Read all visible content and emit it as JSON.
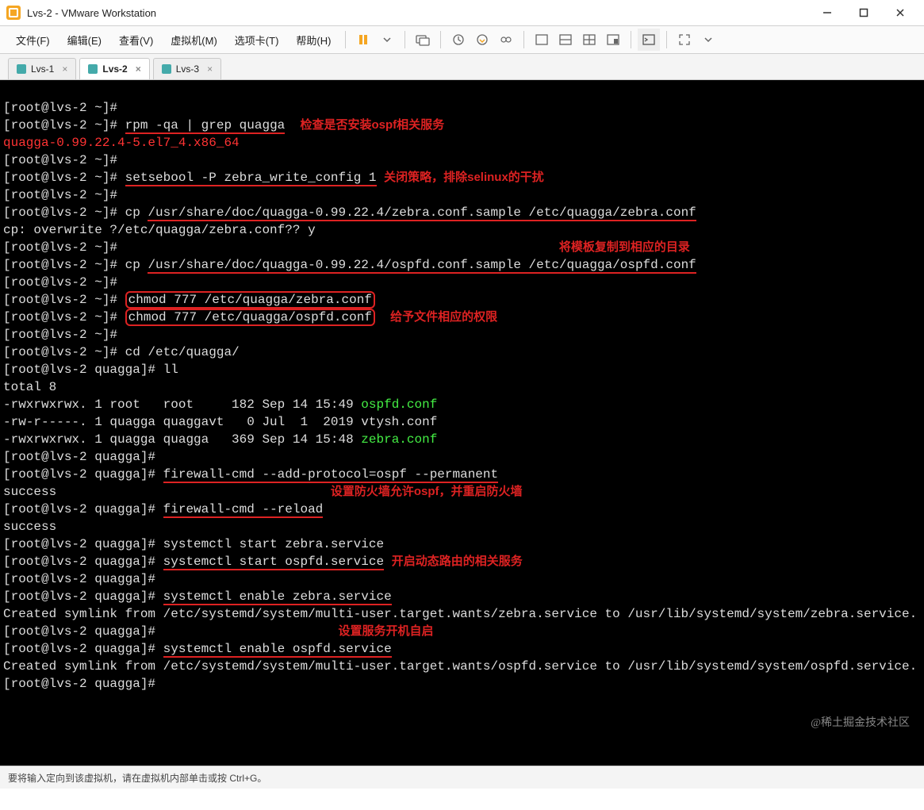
{
  "window": {
    "title": "Lvs-2 - VMware Workstation"
  },
  "menus": {
    "file": "文件(F)",
    "edit": "编辑(E)",
    "view": "查看(V)",
    "vm": "虚拟机(M)",
    "tabs": "选项卡(T)",
    "help": "帮助(H)"
  },
  "tabs": [
    {
      "label": "Lvs-1",
      "active": false,
      "close": "×"
    },
    {
      "label": "Lvs-2",
      "active": true,
      "close": "×"
    },
    {
      "label": "Lvs-3",
      "active": false,
      "close": "×"
    }
  ],
  "annotations": {
    "check_ospf": "检查是否安装ospf相关服务",
    "selinux": "关闭策略，排除selinux的干扰",
    "copy_tpl": "将模板复制到相应的目录",
    "chmod": "给予文件相应的权限",
    "firewall": "设置防火墙允许ospf，并重启防火墙",
    "start_svc": "开启动态路由的相关服务",
    "enable_svc": "设置服务开机自启"
  },
  "watermark": "@稀土掘金技术社区",
  "status": "要将输入定向到该虚拟机，请在虚拟机内部单击或按 Ctrl+G。",
  "term": {
    "prompt_home": "[root@lvs-2 ~]#",
    "prompt_q": "[root@lvs-2 quagga]#",
    "cmd_rpm": "rpm -qa | grep quagga",
    "out_rpm": "quagga-0.99.22.4-5.el7_4.x86_64",
    "cmd_setse": "setsebool -P zebra_write_config 1",
    "cmd_cp_zebra_pre": "cp ",
    "cmd_cp_zebra": "/usr/share/doc/quagga-0.99.22.4/zebra.conf.sample /etc/quagga/zebra.conf",
    "cp_overwrite": "cp: overwrite ?/etc/quagga/zebra.conf?? y",
    "cmd_cp_ospfd_pre": "cp ",
    "cmd_cp_ospfd": "/usr/share/doc/quagga-0.99.22.4/ospfd.conf.sample /etc/quagga/ospfd.conf",
    "cmd_chmod_z": "chmod 777 /etc/quagga/zebra.conf",
    "cmd_chmod_o": "chmod 777 /etc/quagga/ospfd.conf",
    "cmd_cd": "cd /etc/quagga/",
    "cmd_ll": "ll",
    "total": "total 8",
    "ll1a": "-rwxrwxrwx. 1 root   root     182 Sep 14 15:49 ",
    "ll1b": "ospfd.conf",
    "ll2": "-rw-r-----. 1 quagga quaggavt   0 Jul  1  2019 vtysh.conf",
    "ll3a": "-rwxrwxrwx. 1 quagga quagga   369 Sep 14 15:48 ",
    "ll3b": "zebra.conf",
    "cmd_fw1": "firewall-cmd --add-protocol=ospf --permanent",
    "success": "success",
    "cmd_fw2": "firewall-cmd --reload",
    "cmd_s_zebra": "systemctl start zebra.service",
    "cmd_s_ospfd": "systemctl start ospfd.service",
    "cmd_e_zebra": "systemctl enable zebra.service",
    "sym_zebra": "Created symlink from /etc/systemd/system/multi-user.target.wants/zebra.service to /usr/lib/systemd/system/zebra.service.",
    "cmd_e_ospfd": "systemctl enable ospfd.service",
    "sym_ospfd": "Created symlink from /etc/systemd/system/multi-user.target.wants/ospfd.service to /usr/lib/systemd/system/ospfd.service."
  }
}
